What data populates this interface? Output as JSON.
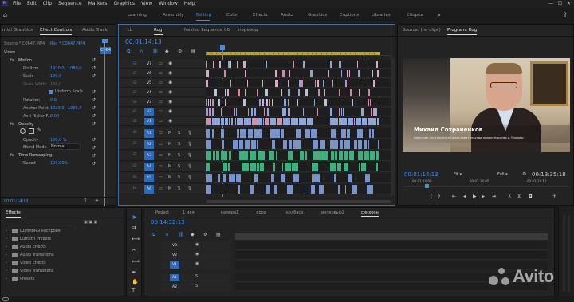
{
  "menu": [
    "File",
    "Edit",
    "Clip",
    "Sequence",
    "Markers",
    "Graphics",
    "View",
    "Window",
    "Help"
  ],
  "workspaces": [
    "Learning",
    "Assembly",
    "Editing",
    "Color",
    "Effects",
    "Audio",
    "Graphics",
    "Captions",
    "Libraries",
    "Сборка"
  ],
  "workspace_active": "Editing",
  "left_tabs": [
    "ntial Graphics",
    "Effect Controls",
    "Audio Track"
  ],
  "ec_source": "Source * C0647.MP4",
  "ec_seq": "Rog * C0647.MP4",
  "ec_clip": "C064",
  "ec_video_label": "Video",
  "ec_params": {
    "motion": "Motion",
    "position": "Position",
    "position_x": "1920,0",
    "position_y": "1080,0",
    "scale": "Scale",
    "scale_val": "100,0",
    "scale_width": "Scale Width",
    "scale_width_val": "100,0",
    "uniform": "Uniform Scale",
    "rotation": "Rotation",
    "rotation_val": "0,0",
    "anchor": "Anchor Point",
    "anchor_x": "1920,0",
    "anchor_y": "1080,0",
    "flicker": "Anti-flicker F...",
    "flicker_val": "0,00",
    "opacity_hdr": "Opacity",
    "opacity": "Opacity",
    "opacity_val": "100,0 %",
    "blend": "Blend Mode",
    "blend_val": "Normal",
    "time_remap": "Time Remapping",
    "speed": "Speed",
    "speed_val": "100,00%"
  },
  "ec_timecode": "00:01:14:13",
  "seq_tabs": [
    "1b",
    "Rog",
    "Nested Sequence 06",
    "перевод"
  ],
  "seq_tab_active": "Rog",
  "seq_timecode": "00:01:14:13",
  "video_tracks": [
    "V7",
    "V6",
    "V5",
    "V4",
    "V3",
    "V2",
    "V1"
  ],
  "audio_tracks": [
    "A1",
    "A2",
    "A3",
    "A4",
    "A5",
    "A6"
  ],
  "program_tabs": [
    "Source: (no clips)",
    "Program: Rog"
  ],
  "program_active": "Program: Rog",
  "lower_third_name": "Михаил Сохраненков",
  "lower_third_sub": "советник постоянного представительства правительства г. Москвы",
  "program_tc_left": "00:01:14:13",
  "program_fit": "Fit",
  "program_quality": "Full",
  "program_tc_right": "00:13:35:18",
  "program_ruler": [
    "00:01:14:00",
    "00:01:14:05",
    "00:01:14:10"
  ],
  "effects_title": "Effects",
  "effects_items": [
    "Шаблоны настроек",
    "Lumetri Presets",
    "Audio Effects",
    "Audio Transitions",
    "Video Effects",
    "Video Transitions",
    "Presets"
  ],
  "bottom_tabs": [
    "Project",
    "1 мая",
    "камера1",
    "дрон",
    "колбаса",
    "интервью2",
    "синхрон"
  ],
  "bottom_tab_active": "синхрон",
  "bottom_timecode": "00:14:32:13",
  "bottom_tracks": [
    "V3",
    "V2",
    "V1",
    "A1",
    "A2"
  ],
  "watermark": "Avito",
  "colors": {
    "accent": "#3f8ff0",
    "bg": "#1b1b1b",
    "panel": "#232323",
    "audio_clip": "#3fa87a",
    "video_clip": "#7f9bd1"
  }
}
